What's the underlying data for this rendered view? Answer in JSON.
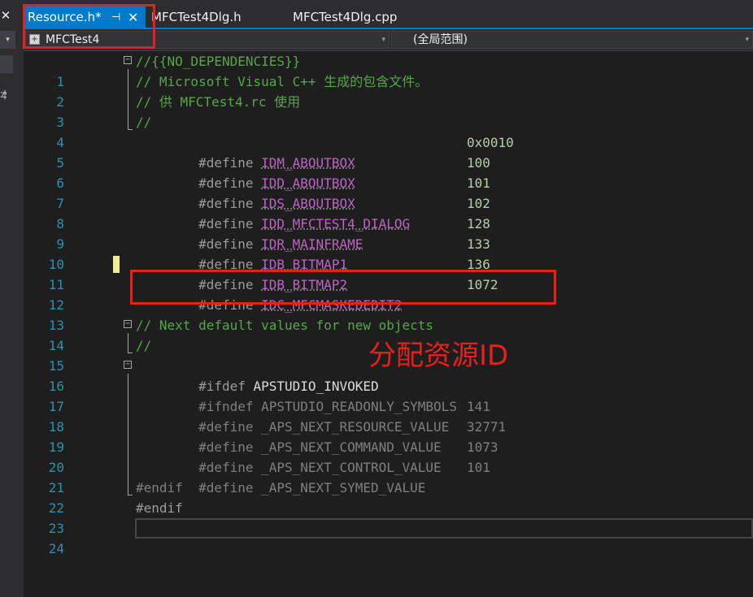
{
  "left_strip": {
    "close_glyph": "✕",
    "dropdown_glyph": "▾",
    "cut_char": "本"
  },
  "tabs": [
    {
      "label": "Resource.h*",
      "active": true,
      "pin_glyph": "⊣",
      "close_glyph": "✕"
    },
    {
      "label": "MFCTest4Dlg.h",
      "active": false
    },
    {
      "label": "MFCTest4Dlg.cpp",
      "active": false
    }
  ],
  "nav": {
    "project": "MFCTest4",
    "scope": "(全局范围)",
    "arrow": "▾"
  },
  "fold_glyph": "−",
  "lines": [
    {
      "n": "1",
      "text": "//{{NO_DEPENDENCIES}}"
    },
    {
      "n": "2",
      "text": "// Microsoft Visual C++ 生成的包含文件。"
    },
    {
      "n": "3",
      "text": "// 供 MFCTest4.rc 使用"
    },
    {
      "n": "4",
      "text": "//"
    },
    {
      "n": "5",
      "define": "#define ",
      "name": "IDM_ABOUTBOX",
      "value": "0x0010"
    },
    {
      "n": "6",
      "define": "#define ",
      "name": "IDD_ABOUTBOX",
      "value": "100"
    },
    {
      "n": "7",
      "define": "#define ",
      "name": "IDS_ABOUTBOX",
      "value": "101"
    },
    {
      "n": "8",
      "define": "#define ",
      "name": "IDD_MFCTEST4_DIALOG",
      "value": "102"
    },
    {
      "n": "9",
      "define": "#define ",
      "name": "IDR_MAINFRAME",
      "value": "128"
    },
    {
      "n": "10",
      "define": "#define ",
      "name": "IDB_BITMAP1",
      "value": "133"
    },
    {
      "n": "11",
      "define": "#define ",
      "name": "IDB_BITMAP2",
      "value": "136"
    },
    {
      "n": "12",
      "define": "#define ",
      "name": "IDC_MFCMASKEDEDIT2",
      "value": "1072"
    },
    {
      "n": "13",
      "text": ""
    },
    {
      "n": "14",
      "text": "// Next default values for new objects"
    },
    {
      "n": "15",
      "text": "//"
    },
    {
      "n": "16",
      "kw": "#ifdef ",
      "name": "APSTUDIO_INVOKED"
    },
    {
      "n": "17",
      "kw": "#ifndef ",
      "name": "APSTUDIO_READONLY_SYMBOLS"
    },
    {
      "n": "18",
      "define": "#define ",
      "name": "_APS_NEXT_RESOURCE_VALUE",
      "value": "141"
    },
    {
      "n": "19",
      "define": "#define ",
      "name": "_APS_NEXT_COMMAND_VALUE",
      "value": "32771"
    },
    {
      "n": "20",
      "define": "#define ",
      "name": "_APS_NEXT_CONTROL_VALUE",
      "value": "1073"
    },
    {
      "n": "21",
      "define": "#define ",
      "name": "_APS_NEXT_SYMED_VALUE",
      "value": "101"
    },
    {
      "n": "22",
      "kw": "#endif"
    },
    {
      "n": "23",
      "kw": "#endif"
    },
    {
      "n": "24",
      "text": ""
    }
  ],
  "annotation": {
    "text": "分配资源ID",
    "color": "#e8201b"
  }
}
